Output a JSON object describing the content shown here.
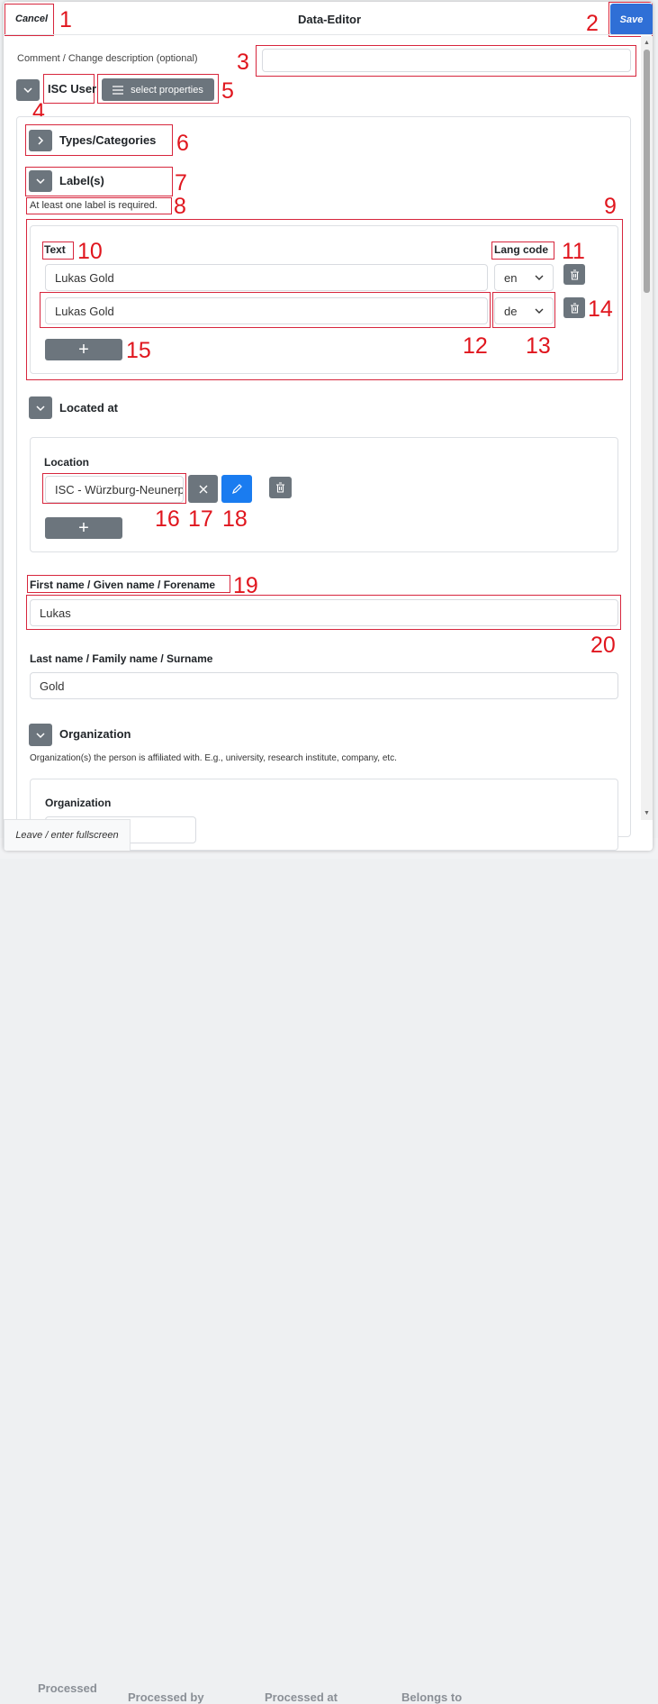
{
  "background_table": {
    "columns": [
      "Processed",
      "Processed by",
      "Processed at",
      "Belongs to"
    ]
  },
  "header": {
    "title": "Data-Editor",
    "cancel_label": "Cancel",
    "save_label": "Save"
  },
  "comment": {
    "label": "Comment / Change description (optional)",
    "value": ""
  },
  "entity": {
    "type_label": "ISC User",
    "select_properties_label": "select properties"
  },
  "types_section": {
    "title": "Types/Categories"
  },
  "labels_section": {
    "title": "Label(s)",
    "hint": "At least one label is required.",
    "text_header": "Text",
    "lang_header": "Lang code",
    "rows": [
      {
        "text": "Lukas Gold",
        "lang": "en"
      },
      {
        "text": "Lukas Gold",
        "lang": "de"
      }
    ]
  },
  "located_section": {
    "title": "Located at",
    "location_label": "Location",
    "location_value": "ISC - Würzburg-Neunerplatz"
  },
  "first_name": {
    "label": "First name / Given name / Forename",
    "value": "Lukas"
  },
  "last_name": {
    "label": "Last name / Family name / Surname",
    "value": "Gold"
  },
  "organization_section": {
    "title": "Organization",
    "description": "Organization(s) the person is affiliated with. E.g., university, research institute, company, etc.",
    "field_label": "Organization"
  },
  "footer": {
    "fullscreen_label": "Leave / enter fullscreen"
  },
  "annotations": [
    "1",
    "2",
    "3",
    "4",
    "5",
    "6",
    "7",
    "8",
    "9",
    "10",
    "11",
    "12",
    "13",
    "14",
    "15",
    "16",
    "17",
    "18",
    "19",
    "20"
  ],
  "colors": {
    "accent": "#2f6fd6",
    "edit_blue": "#1a7cf0",
    "secondary": "#6c757d",
    "annotation_red": "#e0161e"
  }
}
